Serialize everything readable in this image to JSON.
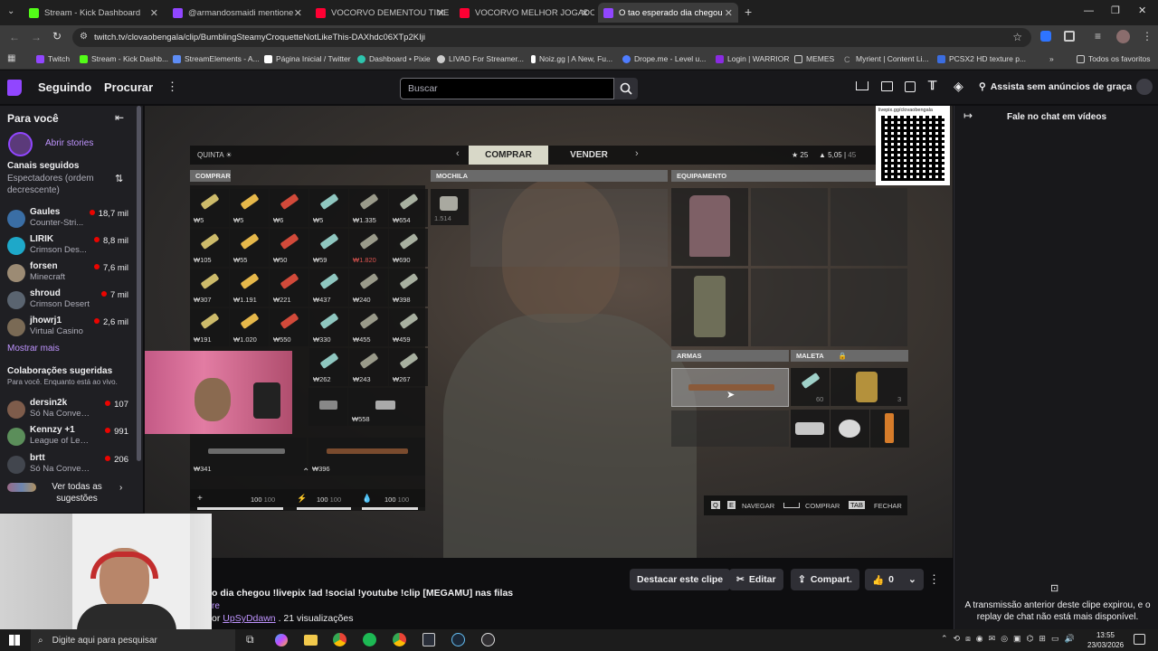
{
  "browser": {
    "tabs": [
      {
        "label": "Stream - Kick Dashboard",
        "color": "#53fc18"
      },
      {
        "label": "@armandosmaidi mentione",
        "color": "#9146ff"
      },
      {
        "label": "VOCORVO DEMENTOU TIME D",
        "color": "#ff0033"
      },
      {
        "label": "VOCORVO MELHOR JOGADOR",
        "color": "#ff0033"
      },
      {
        "label": "O tao esperado dia chegou",
        "color": "#9146ff"
      }
    ],
    "new_tab": "+",
    "url": "twitch.tv/clovaobengala/clip/BumblingSteamyCroquetteNotLikeThis-DAXhdc06XTp2KIji",
    "bookmarks": [
      {
        "label": "Twitch",
        "color": "#9146ff"
      },
      {
        "label": "Stream - Kick Dashb...",
        "color": "#53fc18"
      },
      {
        "label": "StreamElements - A...",
        "color": "#5e8df5"
      },
      {
        "label": "Página Inicial / Twitter",
        "color": "#ffffff"
      },
      {
        "label": "Dashboard • Pixie",
        "color": "#2ec5ae"
      },
      {
        "label": "LIVAD For Streamer...",
        "color": "#cccccc"
      },
      {
        "label": "Noiz.gg | A New, Fu...",
        "color": "#ffffff"
      },
      {
        "label": "Drope.me - Level u...",
        "color": "#4f7dff"
      },
      {
        "label": "Login | WARRIOR",
        "color": "#8a2be2"
      },
      {
        "label": "MEMES",
        "color": "#cccccc"
      },
      {
        "label": "Myrient | Content Li...",
        "color": "#999999"
      },
      {
        "label": "PCSX2 HD texture p...",
        "color": "#3b6de0"
      }
    ],
    "bookmarks_more": "»",
    "all_favorites": "Todos os favoritos"
  },
  "twitch_nav": {
    "following": "Seguindo",
    "browse": "Procurar",
    "search_placeholder": "Buscar",
    "ad_free": "Assista sem anúncios de graça"
  },
  "sidebar": {
    "for_you": "Para você",
    "open_stories": "Abrir stories",
    "followed_title": "Canais seguidos",
    "followed_sort": "Espectadores (ordem decrescente)",
    "followed": [
      {
        "name": "Gaules",
        "game": "Counter-Stri...",
        "viewers": "18,7 mil",
        "color": "#3a6ea5"
      },
      {
        "name": "LIRIK",
        "game": "Crimson Des...",
        "viewers": "8,8 mil",
        "color": "#1ea8c9"
      },
      {
        "name": "forsen",
        "game": "Minecraft",
        "viewers": "7,6 mil",
        "color": "#9c8b74"
      },
      {
        "name": "shroud",
        "game": "Crimson Desert",
        "viewers": "7 mil",
        "color": "#5a6470"
      },
      {
        "name": "jhowrj1",
        "game": "Virtual Casino",
        "viewers": "2,6 mil",
        "color": "#7a6a55"
      }
    ],
    "show_more": "Mostrar mais",
    "collab_title": "Colaborações sugeridas",
    "collab_sub": "Para você. Enquanto está ao vivo.",
    "collab": [
      {
        "name": "dersin2k",
        "game": "Só Na Conversa",
        "viewers": "107",
        "color": "#7e5c4b"
      },
      {
        "name": "Kennzy +1",
        "game": "League of Lege...",
        "viewers": "991",
        "color": "#5b8e5a"
      },
      {
        "name": "brtt",
        "game": "Só Na Conversa",
        "viewers": "206",
        "color": "#42464e"
      }
    ],
    "see_all": "Ver todas as sugestões"
  },
  "game": {
    "day": "QUINTA",
    "tab_buy": "COMPRAR",
    "tab_sell": "VENDER",
    "stars": "25",
    "weight": "5,05",
    "weight_max": "45",
    "buy_header": "COMPRAR",
    "backpack_header": "MOCHILA",
    "equipment_header": "EQUIPAMENTO",
    "weapons_header": "ARMAS",
    "case_header": "MALETA",
    "buy_prices": [
      [
        "₩5",
        "₩5",
        "₩6",
        "₩5",
        "₩1.335",
        "₩654"
      ],
      [
        "₩105",
        "₩55",
        "₩50",
        "₩59",
        "₩1.820",
        "₩690"
      ],
      [
        "₩307",
        "₩1.191",
        "₩221",
        "₩437",
        "₩240",
        "₩398"
      ],
      [
        "₩191",
        "₩1.020",
        "₩550",
        "₩330",
        "₩455",
        "₩459"
      ],
      [
        "",
        "",
        "",
        "₩262",
        "₩243",
        "₩267"
      ]
    ],
    "backpack_count": "1.514",
    "row6_right": "₩558",
    "long1": "₩341",
    "long2": "₩396",
    "health": "100",
    "health_max": "100",
    "stamina": "100",
    "stamina_max": "100",
    "water": "100",
    "water_max": "100",
    "case_count1": "60",
    "case_count2": "3",
    "hint_q": "Q",
    "hint_e": "E",
    "hint_nav": "NAVEGAR",
    "hint_buy": "COMPRAR",
    "hint_tab": "TAB",
    "hint_close": "FECHAR",
    "qr_caption": "livepix.gg/clovaobengala"
  },
  "clip": {
    "highlight": "Destacar este clipe",
    "edit": "Editar",
    "share": "Compart.",
    "likes": "0",
    "title": "o dia chegou !livepix !ad !social !youtube !clip [MEGAMU] nas filas",
    "line2": "re",
    "by": "or",
    "author": "UpSyDdawn",
    "views": ". 21 visualizações"
  },
  "chat": {
    "header": "Fale no chat em vídeos",
    "expired": "A transmissão anterior deste clipe expirou, e o replay de chat não está mais disponível."
  },
  "taskbar": {
    "search": "Digite aqui para pesquisar",
    "time": "13:55",
    "date": "23/03/2026"
  }
}
